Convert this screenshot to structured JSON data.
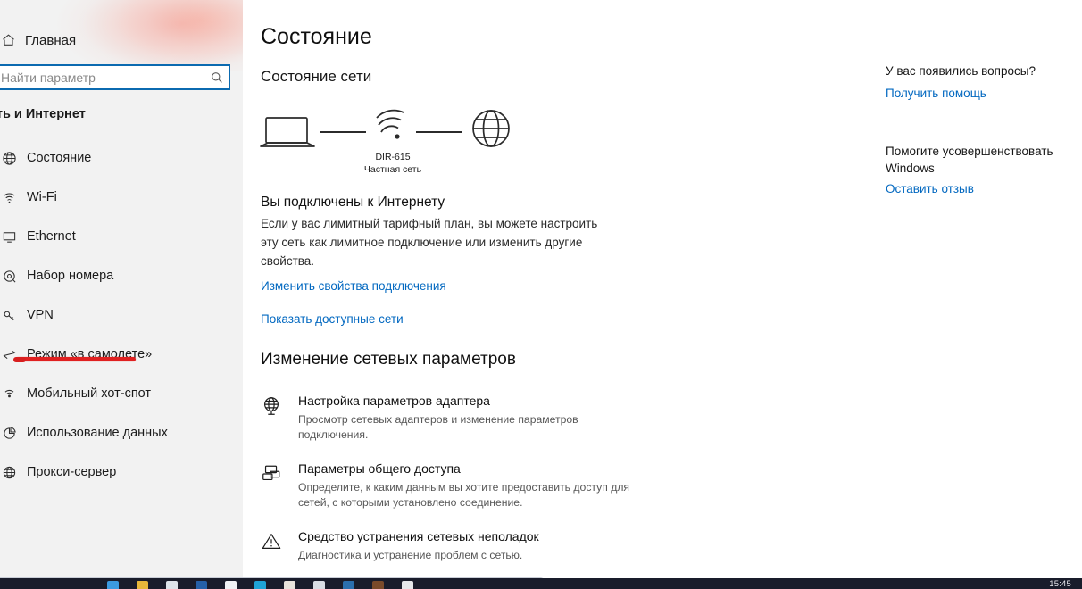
{
  "sidebar": {
    "home_label": "Главная",
    "search": {
      "placeholder": "Найти параметр",
      "value": "",
      "icon": "search-icon"
    },
    "section_header": "еть и Интернет",
    "items": [
      {
        "label": "Состояние",
        "icon": "status-globe-icon",
        "selected": true,
        "underlined": false
      },
      {
        "label": "Wi-Fi",
        "icon": "wifi-icon",
        "selected": false,
        "underlined": false
      },
      {
        "label": "Ethernet",
        "icon": "ethernet-icon",
        "selected": false,
        "underlined": false
      },
      {
        "label": "Набор номера",
        "icon": "dialup-icon",
        "selected": false,
        "underlined": false
      },
      {
        "label": "VPN",
        "icon": "vpn-key-icon",
        "selected": false,
        "underlined": false
      },
      {
        "label": "Режим «в самолете»",
        "icon": "airplane-icon",
        "selected": false,
        "underlined": true
      },
      {
        "label": "Мобильный хот-спот",
        "icon": "hotspot-icon",
        "selected": false,
        "underlined": false
      },
      {
        "label": "Использование данных",
        "icon": "data-usage-icon",
        "selected": false,
        "underlined": false
      },
      {
        "label": "Прокси-сервер",
        "icon": "proxy-globe-icon",
        "selected": false,
        "underlined": false
      }
    ],
    "annotation_color": "#e02020"
  },
  "main": {
    "page_title": "Состояние",
    "section_title": "Состояние сети",
    "diagram": {
      "device_icon": "laptop-icon",
      "network_icon": "wifi-signal-icon",
      "internet_icon": "globe-icon",
      "network_name": "DIR-615",
      "network_type": "Частная сеть"
    },
    "connection": {
      "title": "Вы подключены к Интернету",
      "description": "Если у вас лимитный тарифный план, вы можете настроить эту сеть как лимитное подключение или изменить другие свойства.",
      "link_properties": "Изменить свойства подключения",
      "link_networks": "Показать доступные сети"
    },
    "change_settings": {
      "title": "Изменение сетевых параметров",
      "items": [
        {
          "icon": "adapter-globe-icon",
          "name": "Настройка параметров адаптера",
          "desc": "Просмотр сетевых адаптеров и изменение параметров подключения."
        },
        {
          "icon": "sharing-icon",
          "name": "Параметры общего доступа",
          "desc": "Определите, к каким данным вы хотите предоставить доступ для сетей, с которыми установлено соединение."
        },
        {
          "icon": "warning-triangle-icon",
          "name": "Средство устранения сетевых неполадок",
          "desc": "Диагностика и устранение проблем с сетью."
        }
      ]
    }
  },
  "right_panel": {
    "help_heading": "У вас появились вопросы?",
    "help_link": "Получить помощь",
    "feedback_heading": "Помогите усовершенствовать Windows",
    "feedback_link": "Оставить отзыв",
    "link_color": "#0268c0"
  },
  "taskbar": {
    "clock": "15:45",
    "background": "#191c2b",
    "icons": [
      "#3b9ae1",
      "#e8b73a",
      "#dde3ea",
      "#2560a8",
      "#f0f2f5",
      "#1fa3d6",
      "#e8e3dc",
      "#d9dde4",
      "#2b6fae",
      "#7a4a2a",
      "#e5e7ea"
    ]
  }
}
